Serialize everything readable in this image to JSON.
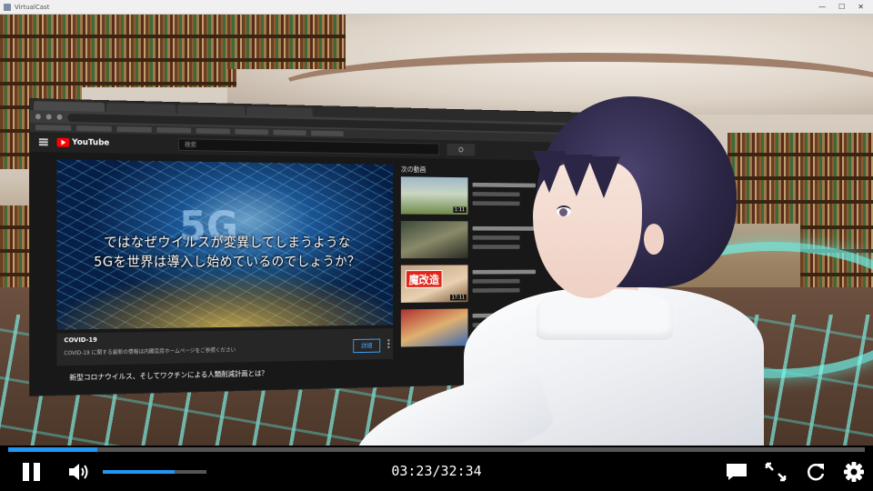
{
  "window": {
    "title": "VirtualCast",
    "minimize_glyph": "—",
    "maximize_glyph": "☐",
    "close_glyph": "✕"
  },
  "browser": {
    "search_placeholder": "検索",
    "video": {
      "overlay_text": "5G",
      "subtitle_line1": "ではなぜウイルスが変異してしまうような",
      "subtitle_line2": "5Gを世界は導入し始めているのでしょうか？"
    },
    "covid_panel": {
      "title": "COVID-19",
      "body": "COVID-19 に関する最新の情報は内閣官房ホームページをご参照ください",
      "button_label": "詳細"
    },
    "video_title": "新型コロナウイルス、そしてワクチンによる人類削減計画とは？",
    "up_next_label": "次の動画",
    "recommendations": [
      {
        "duration": "1:11"
      },
      {
        "duration": ""
      },
      {
        "badge": "魔改造",
        "duration": "17:11"
      },
      {
        "duration": ""
      }
    ]
  },
  "player": {
    "current_time": "03:23",
    "total_time": "32:34",
    "time_display": "03:23/32:34",
    "progress_fraction": 0.104,
    "volume_fraction": 0.69,
    "accent_color": "#2196f3",
    "icons": [
      "pause-icon",
      "volume-icon",
      "chat-icon",
      "fullscreen-icon",
      "replay-icon",
      "gear-icon"
    ]
  }
}
